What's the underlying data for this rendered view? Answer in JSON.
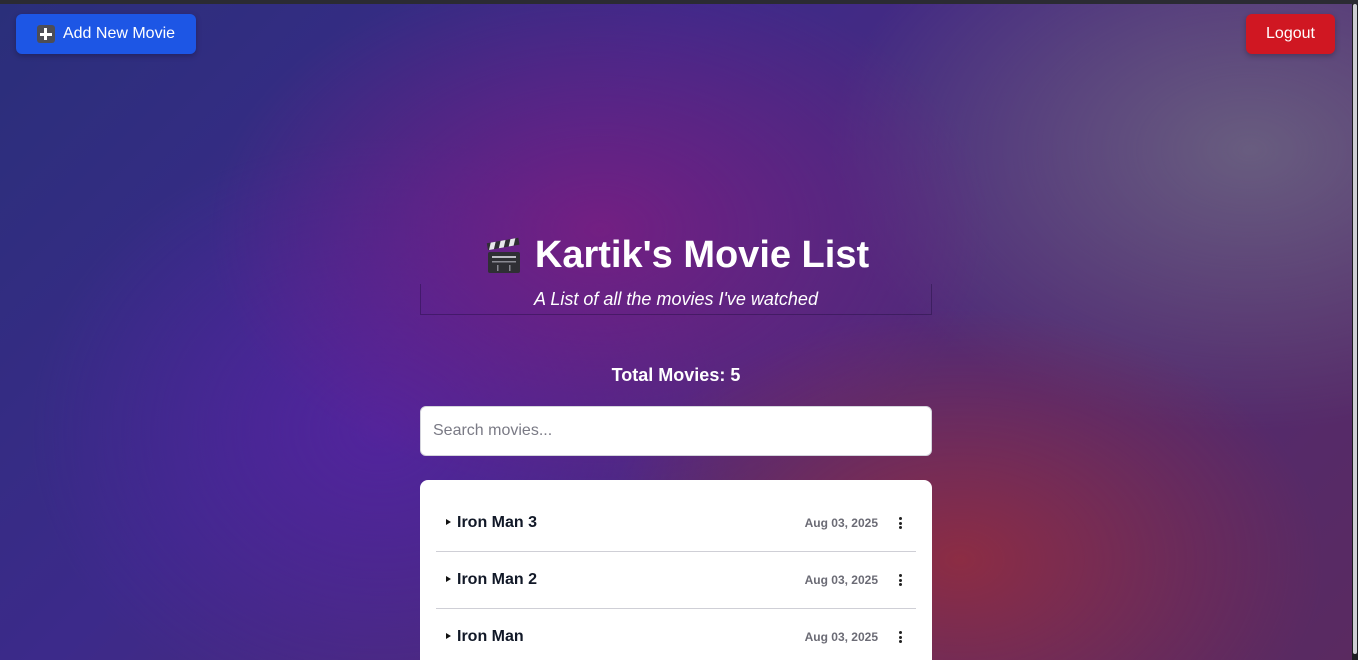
{
  "header": {
    "add_button_label": "Add New Movie",
    "add_button_icon": "plus-icon",
    "logout_label": "Logout"
  },
  "hero": {
    "title_icon": "clapper-board-icon",
    "title": "Kartik's Movie List",
    "subtitle": "A List of all the movies I've watched"
  },
  "stats": {
    "total_label": "Total Movies: 5"
  },
  "search": {
    "placeholder": "Search movies...",
    "value": ""
  },
  "movies": [
    {
      "title": "Iron Man 3",
      "date": "Aug 03, 2025"
    },
    {
      "title": "Iron Man 2",
      "date": "Aug 03, 2025"
    },
    {
      "title": "Iron Man",
      "date": "Aug 03, 2025"
    }
  ],
  "colors": {
    "add_button": "#1d56e5",
    "logout_button": "#d01722",
    "card": "#ffffff"
  }
}
